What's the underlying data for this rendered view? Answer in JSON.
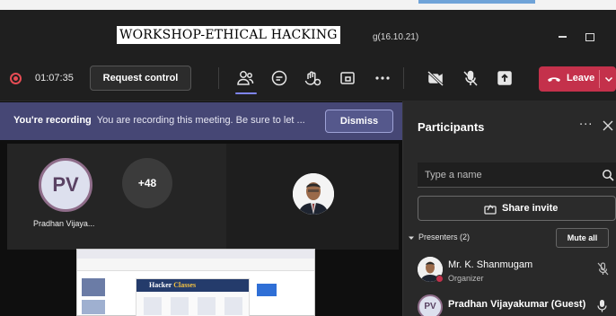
{
  "window": {
    "title": "WORKSHOP-ETHICAL HACKING",
    "title_suffix": "g(16.10.21)"
  },
  "toolbar": {
    "elapsed_time": "01:07:35",
    "request_control_label": "Request control",
    "leave_label": "Leave",
    "icons": [
      "people-icon",
      "chat-icon",
      "reactions-icon",
      "breakout-rooms-icon",
      "more-icon",
      "camera-off-icon",
      "mic-off-icon",
      "share-tray-icon"
    ]
  },
  "recording_banner": {
    "heading": "You're recording",
    "message": "You are recording this meeting. Be sure to let ...",
    "dismiss_label": "Dismiss"
  },
  "stage": {
    "tiles": [
      {
        "initials": "PV",
        "name": "Pradhan Vijaya..."
      },
      {
        "overflow_count": "+48"
      }
    ],
    "shared_screen": {
      "card_title_a": "Hacker",
      "card_title_b": "Classes"
    }
  },
  "participants_panel": {
    "title": "Participants",
    "search_placeholder": "Type a name",
    "share_invite_label": "Share invite",
    "presenters_label": "Presenters (2)",
    "mute_all_label": "Mute all",
    "presenters": [
      {
        "name": "Mr. K. Shanmugam",
        "role": "Organizer"
      },
      {
        "initials": "PV",
        "name": "Pradhan Vijayakumar (Guest)"
      }
    ]
  },
  "colors": {
    "leave_red": "#c4314b",
    "banner_purple": "#464775",
    "accent": "#7f85f5",
    "recording_red": "#e64c54"
  }
}
